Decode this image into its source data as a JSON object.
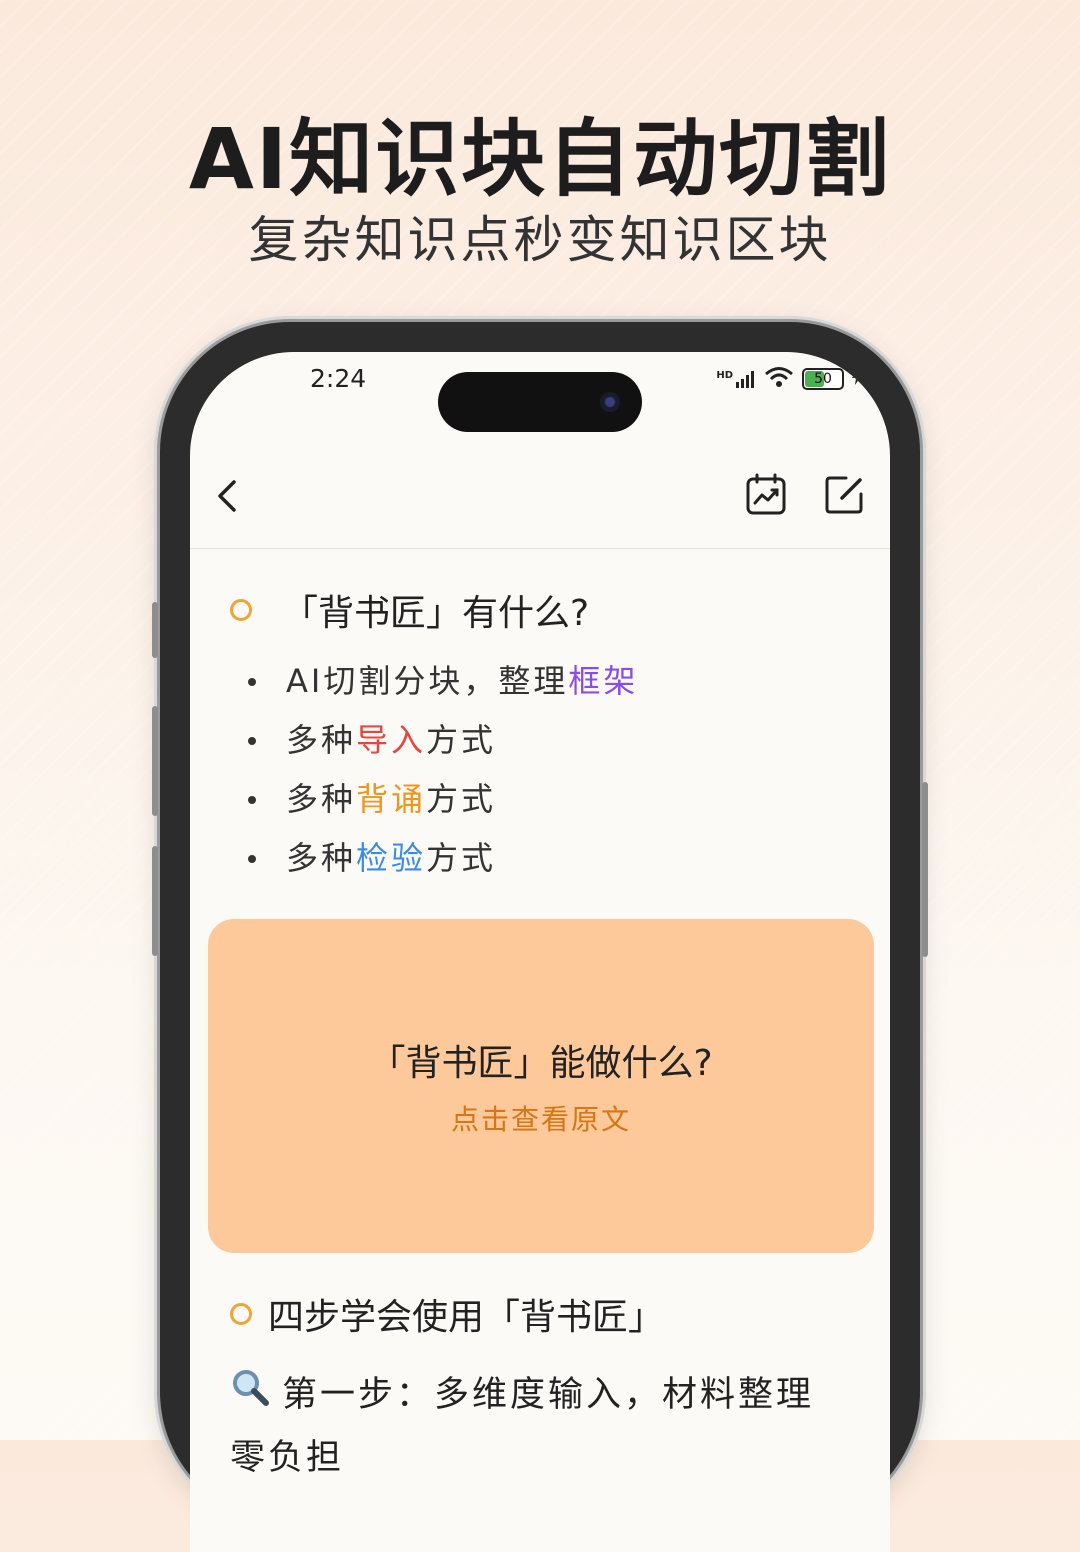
{
  "headline": "AI知识块自动切割",
  "subheadline": "复杂知识点秒变知识区块",
  "status_bar": {
    "time": "2:24",
    "network_label": "HD",
    "battery_level": "50"
  },
  "nav": {
    "back_icon": "chevron-left-icon",
    "stats_icon": "calendar-chart-icon",
    "edit_icon": "edit-icon"
  },
  "section1": {
    "title": "「背书匠」有什么?",
    "items": [
      {
        "prefix": "AI切割分块，整理",
        "highlight": "框架",
        "suffix": "",
        "highlight_color": "#8a4ee8"
      },
      {
        "prefix": "多种",
        "highlight": "导入",
        "suffix": "方式",
        "highlight_color": "#e4483d"
      },
      {
        "prefix": "多种",
        "highlight": "背诵",
        "suffix": "方式",
        "highlight_color": "#f0951e"
      },
      {
        "prefix": "多种",
        "highlight": "检验",
        "suffix": "方式",
        "highlight_color": "#3a8ce8"
      }
    ]
  },
  "card": {
    "title": "「背书匠」能做什么?",
    "link": "点击查看原文",
    "background": "#fdc89a"
  },
  "section2": {
    "title": "四步学会使用「背书匠」",
    "step_icon": "magnifier-icon",
    "step_text": "第一步：多维度输入，材料整理零负担"
  },
  "colors": {
    "accent_orange": "#f0a23b",
    "link_orange": "#d77614"
  }
}
